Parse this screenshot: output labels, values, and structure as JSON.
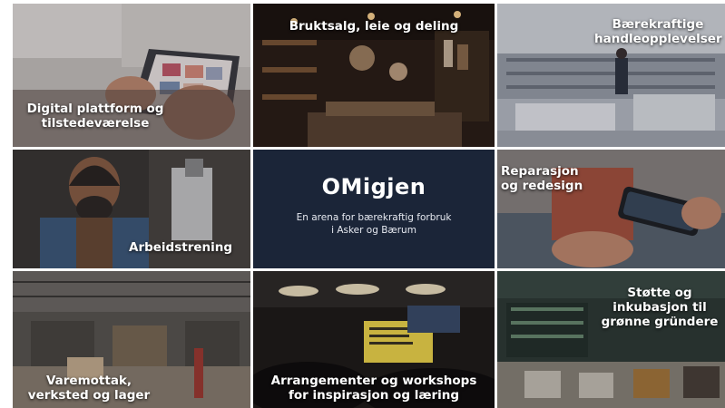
{
  "center": {
    "title": "OMigjen",
    "tagline_line1": "En arena for bærekraftig forbruk",
    "tagline_line2": "i Asker og Bærum"
  },
  "tiles": [
    {
      "label1": "Digital plattform og",
      "label2": "tilstedeværelse"
    },
    {
      "label1": "Bruktsalg, leie og deling",
      "label2": ""
    },
    {
      "label1": "Bærekraftige",
      "label2": "handleopplevelser"
    },
    {
      "label1": "Arbeidstrening",
      "label2": ""
    },
    {
      "label1": "Reparasjon",
      "label2": "og redesign"
    },
    {
      "label1": "Varemottak,",
      "label2": "verksted og lager"
    },
    {
      "label1": "Arrangementer og workshops",
      "label2": "for inspirasjon og læring"
    },
    {
      "label1": "Støtte og",
      "label2": "inkubasjon til",
      "label3": "grønne gründere"
    }
  ],
  "colors": {
    "center_bg": "#1b2538",
    "text": "#ffffff"
  }
}
